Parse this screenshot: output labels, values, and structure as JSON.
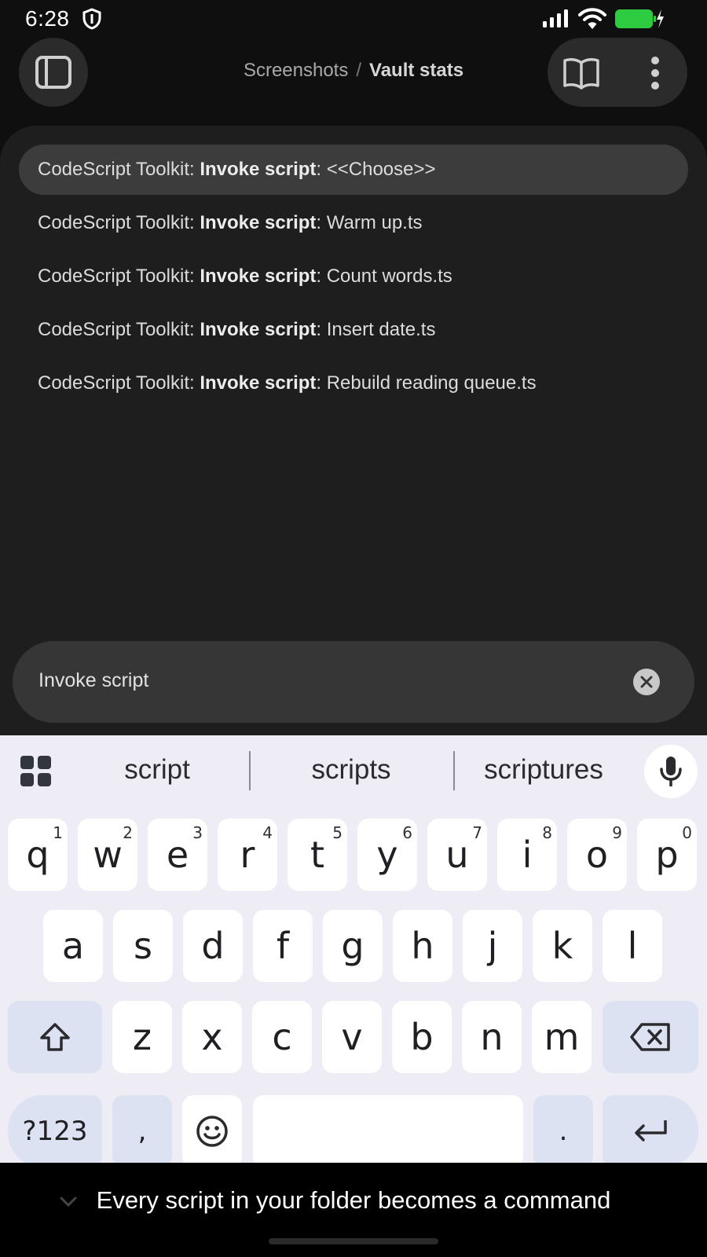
{
  "status_bar": {
    "time": "6:28"
  },
  "header": {
    "breadcrumb_folder": "Screenshots",
    "breadcrumb_separator": "/",
    "breadcrumb_file": "Vault stats"
  },
  "palette": {
    "suggestions": [
      {
        "prefix": "CodeScript Toolkit: ",
        "bold": "Invoke script",
        "suffix": ": <<Choose>>",
        "selected": true
      },
      {
        "prefix": "CodeScript Toolkit: ",
        "bold": "Invoke script",
        "suffix": ": Warm up.ts",
        "selected": false
      },
      {
        "prefix": "CodeScript Toolkit: ",
        "bold": "Invoke script",
        "suffix": ": Count words.ts",
        "selected": false
      },
      {
        "prefix": "CodeScript Toolkit: ",
        "bold": "Invoke script",
        "suffix": ": Insert date.ts",
        "selected": false
      },
      {
        "prefix": "CodeScript Toolkit: ",
        "bold": "Invoke script",
        "suffix": ": Rebuild reading queue.ts",
        "selected": false
      }
    ],
    "query": "Invoke script"
  },
  "keyboard": {
    "word_suggestions": [
      "script",
      "scripts",
      "scriptures"
    ],
    "row1": [
      "q",
      "w",
      "e",
      "r",
      "t",
      "y",
      "u",
      "i",
      "o",
      "p"
    ],
    "row1_numbers": [
      "1",
      "2",
      "3",
      "4",
      "5",
      "6",
      "7",
      "8",
      "9",
      "0"
    ],
    "row2": [
      "a",
      "s",
      "d",
      "f",
      "g",
      "h",
      "j",
      "k",
      "l"
    ],
    "row3": [
      "z",
      "x",
      "c",
      "v",
      "b",
      "n",
      "m"
    ],
    "symbols_key": "?123",
    "comma_key": ",",
    "period_key": "."
  },
  "caption": "Every script in your folder becomes a command",
  "icons": {
    "status": [
      "shield-icon",
      "signal-icon",
      "wifi-icon",
      "battery-charging-icon"
    ],
    "header": [
      "sidebar-toggle-icon",
      "book-icon",
      "more-vertical-icon"
    ],
    "search": "clear-icon",
    "keyboard": [
      "grid-icon",
      "mic-icon",
      "shift-icon",
      "backspace-icon",
      "emoji-icon",
      "enter-icon"
    ],
    "caption": "chevron-down-icon"
  },
  "colors": {
    "battery": "#2ecc40",
    "selected_row": "#3c3c3c",
    "keyboard_bg": "#eeedf5",
    "modifier_key": "#dde2f3"
  }
}
